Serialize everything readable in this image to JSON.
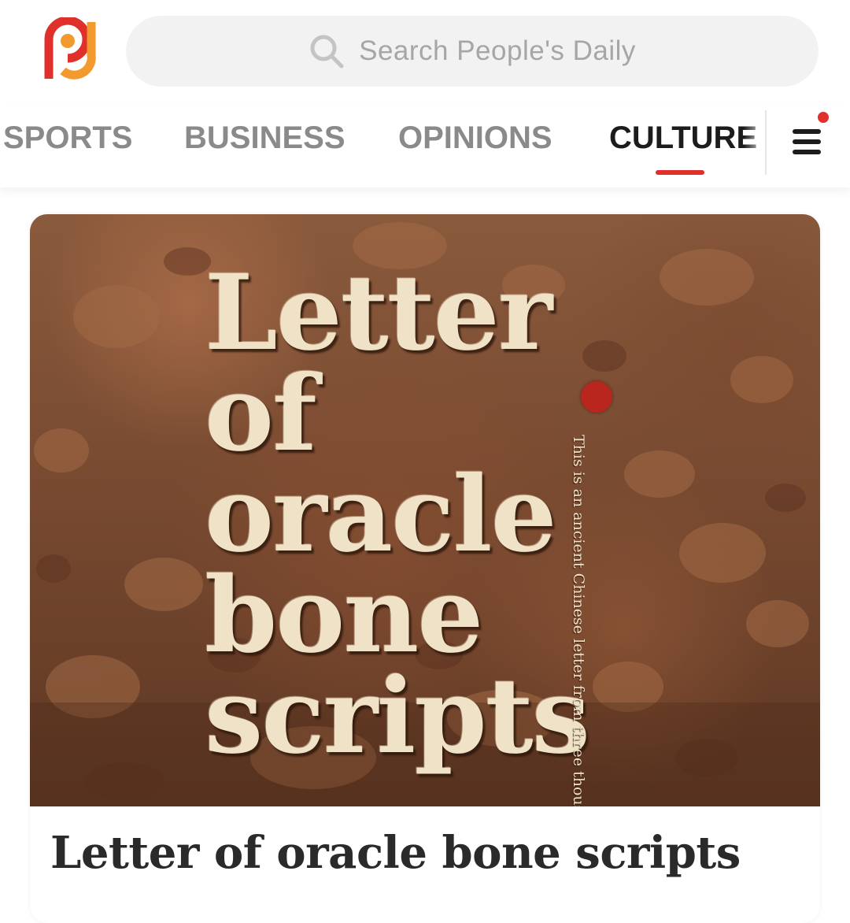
{
  "app": {
    "name": "People's Daily"
  },
  "header": {
    "search": {
      "placeholder": "Search People's Daily"
    }
  },
  "nav": {
    "tabs": [
      {
        "label": "SPORTS",
        "active": false
      },
      {
        "label": "BUSINESS",
        "active": false
      },
      {
        "label": "OPINIONS",
        "active": false
      },
      {
        "label": "CULTURE",
        "active": true
      }
    ],
    "menu_icon": "hamburger-menu-icon",
    "menu_has_notification": true
  },
  "article": {
    "hero": {
      "title_lines": [
        "Letter of",
        "oracle",
        "bone",
        "scripts"
      ],
      "vertical_caption": "This is an ancient Chinese letter from three thousand years ago"
    },
    "title": "Letter of oracle bone scripts"
  },
  "colors": {
    "accent": "#e0302b",
    "logo_red": "#e0302b",
    "logo_orange": "#f29a2e",
    "inactive_tab": "#8a8a8a",
    "active_tab": "#1c1c1c"
  }
}
